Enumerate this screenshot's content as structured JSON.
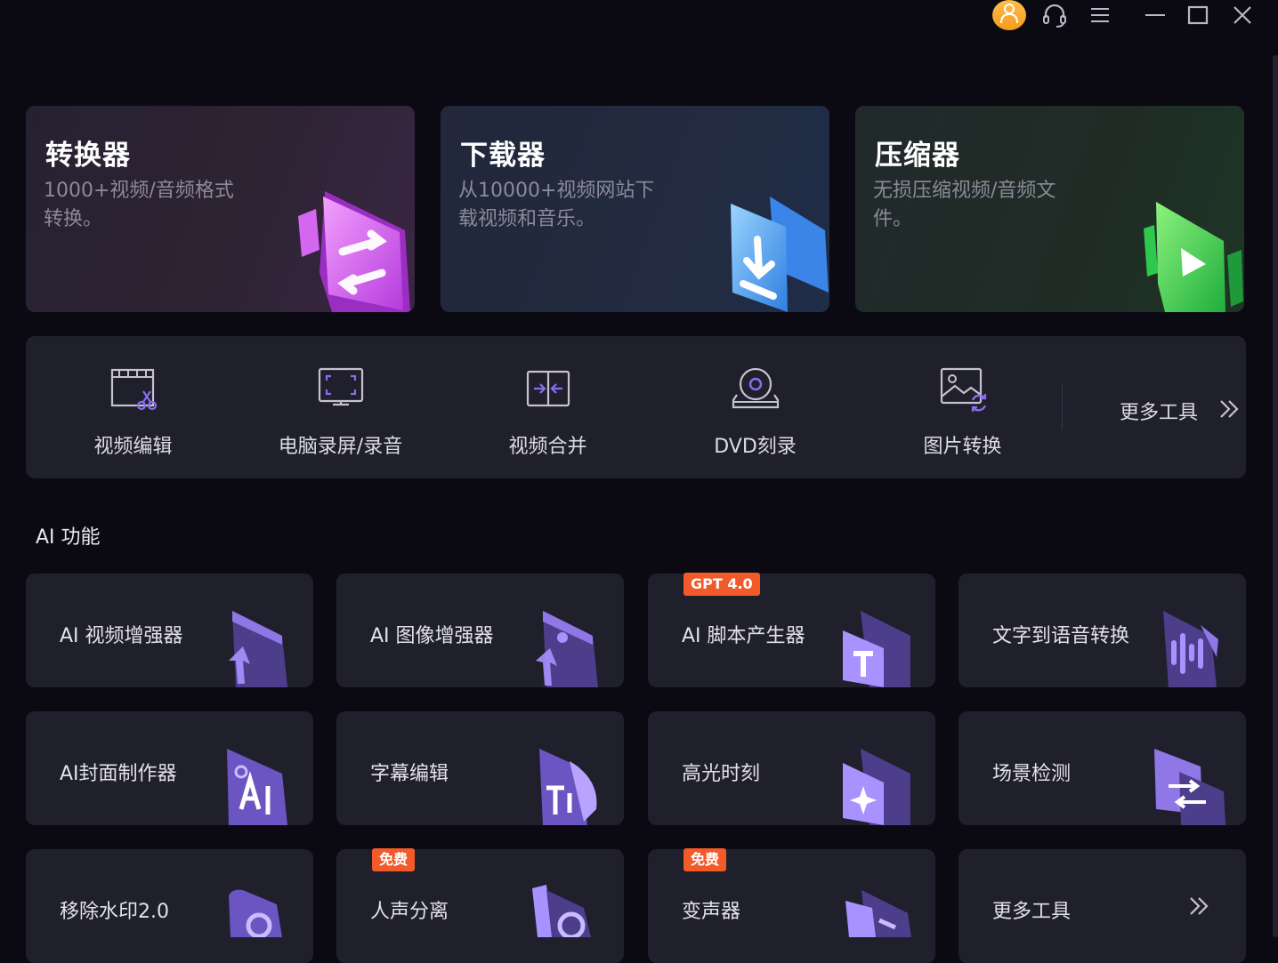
{
  "window": {
    "icons": [
      "avatar-icon",
      "headset-icon",
      "menu-icon",
      "minimize-icon",
      "maximize-icon",
      "close-icon"
    ]
  },
  "hero_cards": [
    {
      "title": "转换器",
      "desc": "1000+视频/音频格式转换。",
      "color": "#c23ee0"
    },
    {
      "title": "下载器",
      "desc": "从10000+视频网站下载视频和音乐。",
      "color": "#2f8be6"
    },
    {
      "title": "压缩器",
      "desc": "无损压缩视频/音频文件。",
      "color": "#22c24a"
    }
  ],
  "tools": [
    {
      "label": "视频编辑",
      "icon": "video-edit-icon"
    },
    {
      "label": "电脑录屏/录音",
      "icon": "screen-record-icon"
    },
    {
      "label": "视频合并",
      "icon": "video-merge-icon"
    },
    {
      "label": "DVD刻录",
      "icon": "dvd-burn-icon"
    },
    {
      "label": "图片转换",
      "icon": "image-convert-icon"
    }
  ],
  "more_tools_top": "更多工具",
  "ai_section": {
    "title": "AI 功能"
  },
  "ai_cards": [
    {
      "label": "AI 视频增强器",
      "badge": ""
    },
    {
      "label": "AI 图像增强器",
      "badge": ""
    },
    {
      "label": "AI 脚本产生器",
      "badge": "GPT 4.0"
    },
    {
      "label": "文字到语音转换",
      "badge": ""
    },
    {
      "label": "AI封面制作器",
      "badge": ""
    },
    {
      "label": "字幕编辑",
      "badge": ""
    },
    {
      "label": "高光时刻",
      "badge": ""
    },
    {
      "label": "场景检测",
      "badge": ""
    },
    {
      "label": "移除水印2.0",
      "badge": ""
    },
    {
      "label": "人声分离",
      "badge": "免费"
    },
    {
      "label": "变声器",
      "badge": "免费"
    }
  ],
  "more_tools_bottom": "更多工具",
  "colors": {
    "accent": "#8b6cf0",
    "badge": "#f25a2a",
    "panel": "#201f2c",
    "background": "#0b0a13"
  }
}
